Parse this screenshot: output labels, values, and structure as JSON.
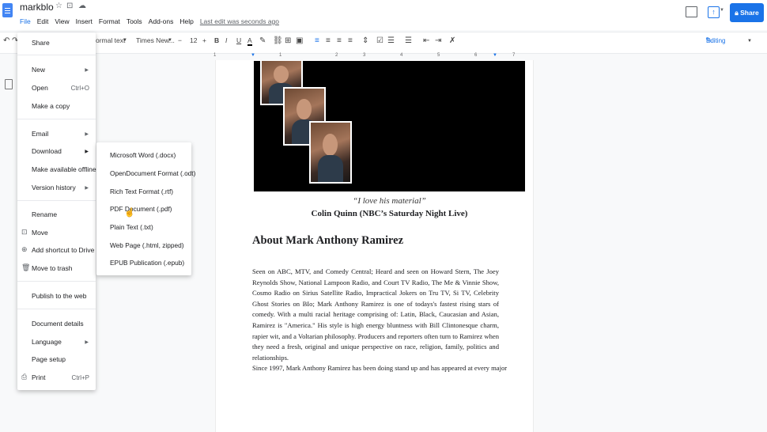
{
  "app": {
    "title": "markblo",
    "menus": [
      "File",
      "Edit",
      "View",
      "Insert",
      "Format",
      "Tools",
      "Add-ons",
      "Help"
    ],
    "last_edit": "Last edit was seconds ago",
    "share_label": "Share",
    "present_glyph": "↑"
  },
  "toolbar": {
    "style": "ormal text",
    "font": "Times New...",
    "font_size": "12",
    "mode": "Editing",
    "bold": "B",
    "italic": "I",
    "underline": "U",
    "text_color": "A"
  },
  "ruler": [
    "1",
    "1",
    "2",
    "3",
    "4",
    "5",
    "6",
    "7"
  ],
  "file_menu": {
    "share": "Share",
    "new": "New",
    "open": "Open",
    "open_shortcut": "Ctrl+O",
    "make_copy": "Make a copy",
    "email": "Email",
    "download": "Download",
    "make_offline": "Make available offline",
    "version_history": "Version history",
    "rename": "Rename",
    "move": "Move",
    "add_shortcut": "Add shortcut to Drive",
    "trash": "Move to trash",
    "publish": "Publish to the web",
    "details": "Document details",
    "language": "Language",
    "page_setup": "Page setup",
    "print": "Print",
    "print_shortcut": "Ctrl+P"
  },
  "download_menu": [
    "Microsoft Word (.docx)",
    "OpenDocument Format (.odt)",
    "Rich Text Format (.rtf)",
    "PDF Document (.pdf)",
    "Plain Text (.txt)",
    "Web Page (.html, zipped)",
    "EPUB Publication (.epub)"
  ],
  "document": {
    "quote": "“I love his material”",
    "quote_author": "Colin Quinn (NBC’s Saturday Night Live)",
    "heading": "About Mark Anthony Ramirez",
    "paragraph1": "Seen on ABC, MTV, and Comedy Central; Heard and seen on Howard Stern, The Joey Reynolds Show, National Lampoon Radio, and Court TV Radio, The Me & Vinnie Show, Cosmo Radio on Sirius Satellite Radio, Impractical Jokers on Tru TV, Si TV, Celebrity Ghost Stories on BIo; Mark Anthony Ramirez is one of todays's fastest rising stars of comedy. With a multi racial heritage comprising of: Latin, Black, Caucasian and Asian, Ramirez is \"America.\" His style is high energy bluntness with Bill Clintonesque charm, rapier wit, and a Voltarian philosophy. Producers and reporters often turn to Ramirez when they need a fresh, original and unique perspective on race, religion, family, politics and relationships.",
    "paragraph2": "Since 1997, Mark Anthony Ramirez has been doing stand up and has appeared at every major"
  }
}
